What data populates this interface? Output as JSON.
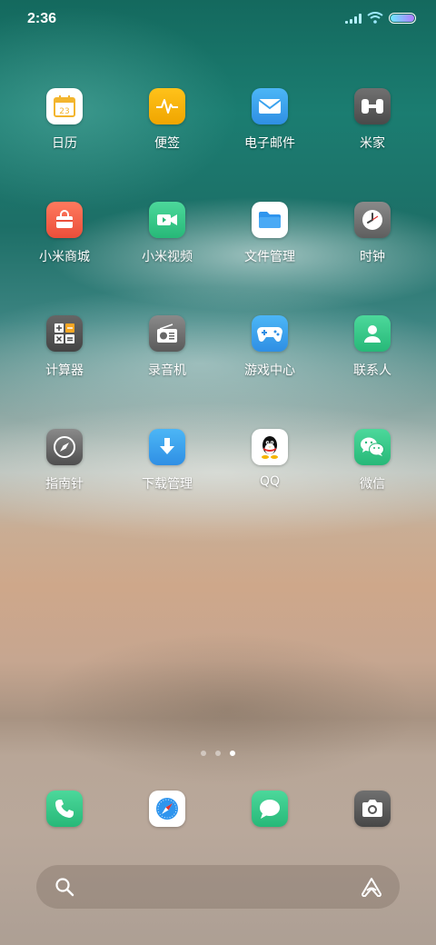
{
  "status_bar": {
    "time": "2:36",
    "icons": [
      "signal-icon",
      "wifi-icon",
      "battery-icon"
    ]
  },
  "apps": [
    {
      "label": "日历",
      "icon": "calendar-icon",
      "icon_text": "23",
      "color": "#ffffff"
    },
    {
      "label": "便签",
      "icon": "notes-icon",
      "color": "#f5b400"
    },
    {
      "label": "电子邮件",
      "icon": "mail-icon",
      "color": "#3aa2ee"
    },
    {
      "label": "米家",
      "icon": "mijia-icon",
      "color": "#5a5a5a"
    },
    {
      "label": "小米商城",
      "icon": "mi-store-icon",
      "color": "#f0624a"
    },
    {
      "label": "小米视频",
      "icon": "video-icon",
      "color": "#35c98a"
    },
    {
      "label": "文件管理",
      "icon": "folder-icon",
      "color": "#ffffff"
    },
    {
      "label": "时钟",
      "icon": "clock-icon",
      "color": "#777777"
    },
    {
      "label": "计算器",
      "icon": "calculator-icon",
      "color": "#555555"
    },
    {
      "label": "录音机",
      "icon": "recorder-icon",
      "color": "#6f6f6f"
    },
    {
      "label": "游戏中心",
      "icon": "game-center-icon",
      "color": "#3a9ff2"
    },
    {
      "label": "联系人",
      "icon": "contacts-icon",
      "color": "#3ccb83"
    },
    {
      "label": "指南针",
      "icon": "compass-icon",
      "color": "#6d6d6d"
    },
    {
      "label": "下载管理",
      "icon": "download-icon",
      "color": "#3aa2ee"
    },
    {
      "label": "QQ",
      "icon": "qq-icon",
      "color": "#ffffff"
    },
    {
      "label": "微信",
      "icon": "wechat-icon",
      "color": "#3ccb83"
    }
  ],
  "page_indicator": {
    "pages": 3,
    "current": 3
  },
  "dock": [
    {
      "icon": "phone-icon",
      "color": "#3ccb83"
    },
    {
      "icon": "browser-icon",
      "color": "#ffffff"
    },
    {
      "icon": "messages-icon",
      "color": "#3ccb83"
    },
    {
      "icon": "camera-icon",
      "color": "#555555"
    }
  ],
  "search_bar": {
    "icons": [
      "search-icon",
      "assistant-icon"
    ]
  }
}
